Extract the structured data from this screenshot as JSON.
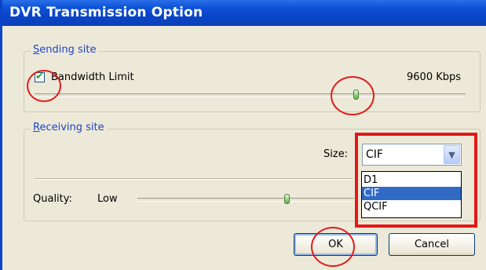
{
  "window": {
    "title": "DVR Transmission Option"
  },
  "sending": {
    "legend": "Sending site",
    "checkbox_label": "Bandwidth Limit",
    "checked": true,
    "bandwidth_value": "9600 Kbps",
    "slider_fraction": 0.73
  },
  "receiving": {
    "legend": "Receiving site",
    "size_label": "Size:",
    "size_selected": "CIF",
    "size_options": [
      "D1",
      "CIF",
      "QCIF"
    ],
    "quality_label": "Quality:",
    "quality_low": "Low",
    "quality_fraction": 0.68
  },
  "buttons": {
    "ok": "OK",
    "cancel": "Cancel"
  },
  "annotations": {
    "highlight_color": "#e31b1b"
  }
}
